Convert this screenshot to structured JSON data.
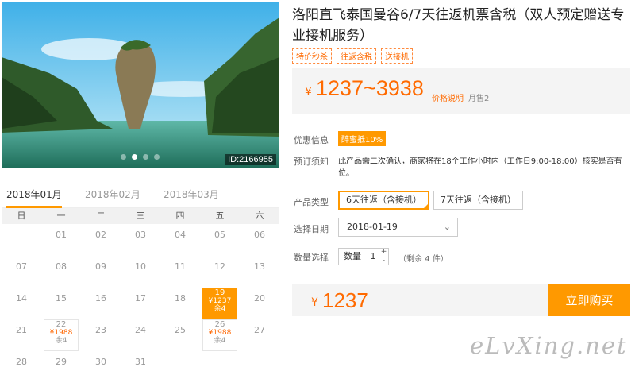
{
  "photo": {
    "image_id": "ID:2166955",
    "carousel_count": 4,
    "carousel_active": 1
  },
  "calendar": {
    "tabs": [
      "2018年01月",
      "2018年02月",
      "2018年03月"
    ],
    "active_tab": 0,
    "weekdays": [
      "日",
      "一",
      "二",
      "三",
      "四",
      "五",
      "六"
    ],
    "cells": [
      {
        "d": ""
      },
      {
        "d": "01"
      },
      {
        "d": "02"
      },
      {
        "d": "03"
      },
      {
        "d": "04"
      },
      {
        "d": "05"
      },
      {
        "d": "06"
      },
      {
        "d": "07"
      },
      {
        "d": "08"
      },
      {
        "d": "09"
      },
      {
        "d": "10"
      },
      {
        "d": "11"
      },
      {
        "d": "12"
      },
      {
        "d": "13"
      },
      {
        "d": "14"
      },
      {
        "d": "15"
      },
      {
        "d": "16"
      },
      {
        "d": "17"
      },
      {
        "d": "18"
      },
      {
        "d": "19",
        "price": "¥1237",
        "stock": "余4",
        "selected": true
      },
      {
        "d": "20"
      },
      {
        "d": "21"
      },
      {
        "d": "22",
        "price": "¥1988",
        "stock": "余4"
      },
      {
        "d": "23"
      },
      {
        "d": "24"
      },
      {
        "d": "25"
      },
      {
        "d": "26",
        "price": "¥1988",
        "stock": "余4"
      },
      {
        "d": "27"
      },
      {
        "d": "28"
      },
      {
        "d": "29"
      },
      {
        "d": "30"
      },
      {
        "d": "31"
      }
    ]
  },
  "product": {
    "title": "洛阳直飞泰国曼谷6/7天往返机票含税（双人预定赠送专业接机服务）",
    "tags": [
      "特价秒杀",
      "往返含税",
      "送接机"
    ],
    "price_symbol": "¥",
    "price_range": "1237~3938",
    "price_note": "价格说明",
    "monthly_sales": "月售2"
  },
  "promo": {
    "label": "优惠信息",
    "badge": "醉蜜抵10%"
  },
  "booking_notice": {
    "label": "预订须知",
    "text": "此产品需二次确认，商家将在18个工作小时内（工作日9:00-18:00）核实是否有位。"
  },
  "options": {
    "type_label": "产品类型",
    "types": [
      "6天往返（含接机）",
      "7天往返（含接机）"
    ],
    "active_type": 0,
    "date_label": "选择日期",
    "date_value": "2018-01-19",
    "qty_label": "数量选择",
    "qty_prefix": "数量",
    "qty_value": "1",
    "stock_text": "（剩余 4 件）"
  },
  "total": {
    "symbol": "¥",
    "price": "1237",
    "buy_label": "立即购买"
  },
  "watermark": "eLvXing.net",
  "colors": {
    "accent": "#ff9900",
    "price": "#ff6a00"
  }
}
